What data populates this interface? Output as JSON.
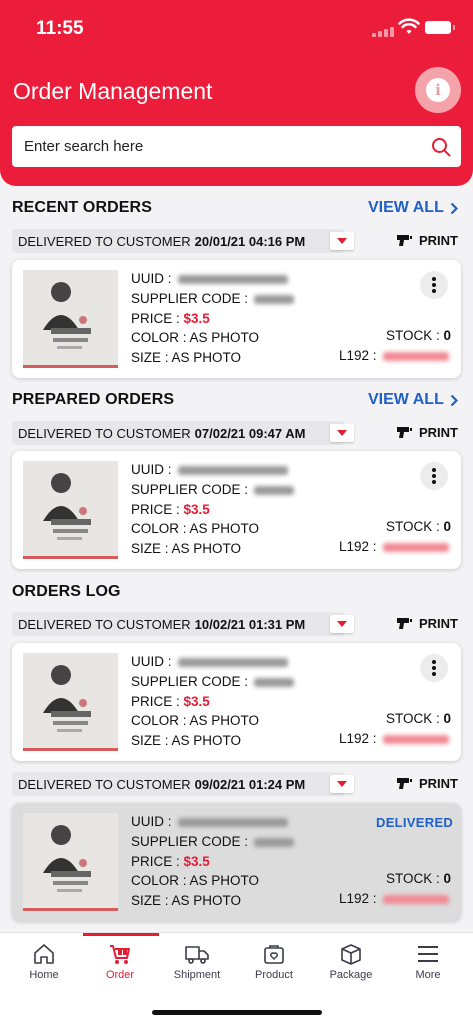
{
  "status_bar": {
    "time": "11:55"
  },
  "header": {
    "title": "Order Management"
  },
  "search": {
    "placeholder": "Enter search here"
  },
  "sections": {
    "recent": {
      "title": "RECENT ORDERS",
      "view_all": "VIEW ALL"
    },
    "prepared": {
      "title": "PREPARED ORDERS",
      "view_all": "VIEW ALL"
    },
    "log": {
      "title": "ORDERS LOG"
    }
  },
  "orders": [
    {
      "status": "DELIVERED TO CUSTOMER",
      "datetime": "20/01/21 04:16 PM",
      "print": "PRINT",
      "uuid_label": "UUID :",
      "supplier_label": "SUPPLIER CODE :",
      "price_label": "PRICE :",
      "price": "$3.5",
      "color": "COLOR : AS PHOTO",
      "size": "SIZE : AS PHOTO",
      "stock_label": "STOCK :",
      "stock": "0",
      "l192_label": "L192 :"
    },
    {
      "status": "DELIVERED TO CUSTOMER",
      "datetime": "07/02/21 09:47 AM",
      "print": "PRINT",
      "uuid_label": "UUID :",
      "supplier_label": "SUPPLIER CODE :",
      "price_label": "PRICE :",
      "price": "$3.5",
      "color": "COLOR : AS PHOTO",
      "size": "SIZE : AS PHOTO",
      "stock_label": "STOCK :",
      "stock": "0",
      "l192_label": "L192 :"
    },
    {
      "status": "DELIVERED TO CUSTOMER",
      "datetime": "10/02/21 01:31 PM",
      "print": "PRINT",
      "uuid_label": "UUID :",
      "supplier_label": "SUPPLIER CODE :",
      "price_label": "PRICE :",
      "price": "$3.5",
      "color": "COLOR : AS PHOTO",
      "size": "SIZE : AS PHOTO",
      "stock_label": "STOCK :",
      "stock": "0",
      "l192_label": "L192 :"
    },
    {
      "status": "DELIVERED TO CUSTOMER",
      "datetime": "09/02/21 01:24 PM",
      "print": "PRINT",
      "uuid_label": "UUID :",
      "supplier_label": "SUPPLIER CODE :",
      "price_label": "PRICE :",
      "price": "$3.5",
      "color": "COLOR : AS PHOTO",
      "size": "SIZE : AS PHOTO",
      "stock_label": "STOCK :",
      "stock": "0",
      "l192_label": "L192 :",
      "badge": "DELIVERED"
    }
  ],
  "tabbar": {
    "items": [
      {
        "label": "Home",
        "icon": "home-icon"
      },
      {
        "label": "Order",
        "icon": "cart-icon",
        "active": true
      },
      {
        "label": "Shipment",
        "icon": "truck-icon"
      },
      {
        "label": "Product",
        "icon": "product-box-icon"
      },
      {
        "label": "Package",
        "icon": "package-icon"
      },
      {
        "label": "More",
        "icon": "menu-icon"
      }
    ]
  },
  "colors": {
    "brand": "#ec1d3a",
    "link": "#1f5fc8",
    "price": "#e41d35"
  }
}
